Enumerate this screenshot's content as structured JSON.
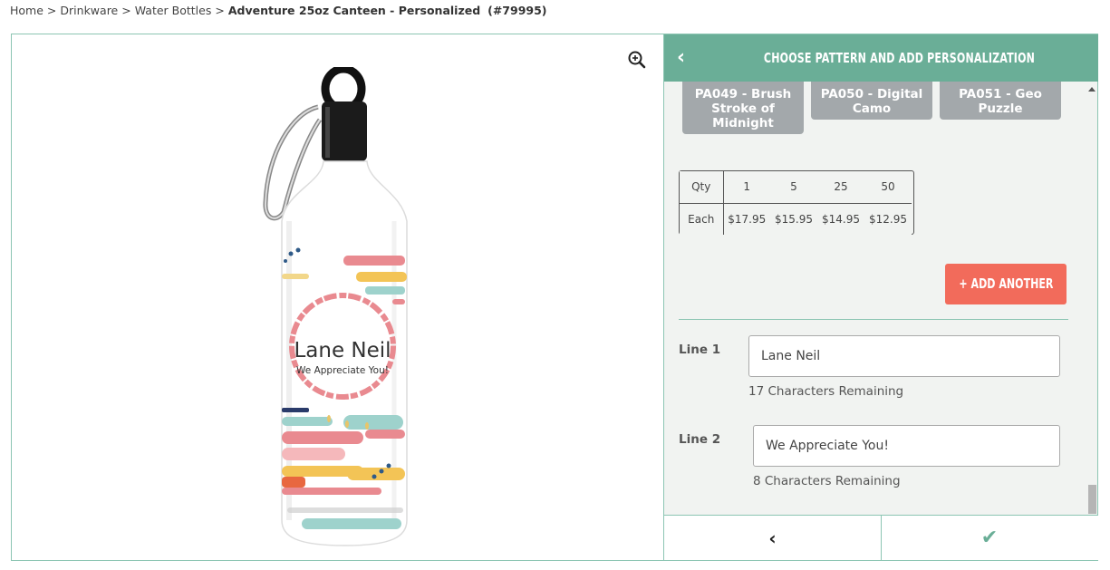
{
  "breadcrumb": {
    "items": [
      "Home",
      "Drinkware",
      "Water Bottles"
    ],
    "separator": ">",
    "current": "Adventure 25oz Canteen - Personalized",
    "sku": "(#79995)"
  },
  "product_image": {
    "text_line1": "Lane Neil",
    "text_line2": "We Appreciate You!"
  },
  "panel": {
    "title": "CHOOSE PATTERN AND ADD PERSONALIZATION",
    "back_icon": "chevron-left-icon",
    "patterns": [
      {
        "label": "PA049 - Brush Stroke of Midnight"
      },
      {
        "label": "PA050 - Digital Camo"
      },
      {
        "label": "PA051 - Geo Puzzle"
      }
    ],
    "pricing": {
      "qty_label": "Qty",
      "each_label": "Each",
      "quantities": [
        "1",
        "5",
        "25",
        "50"
      ],
      "prices": [
        "$17.95",
        "$15.95",
        "$14.95",
        "$12.95"
      ]
    },
    "add_another_label": "+ ADD ANOTHER",
    "line1": {
      "label": "Line 1",
      "value": "Lane Neil",
      "remaining": "17 Characters Remaining"
    },
    "line2": {
      "label": "Line 2",
      "value": "We Appreciate You!",
      "remaining": "8 Characters Remaining"
    },
    "footer": {
      "prev_glyph": "‹",
      "confirm_glyph": "✔"
    }
  },
  "colors": {
    "header_green": "#6aae97",
    "add_button": "#f26b5b",
    "pattern_card": "#a3a8ab"
  }
}
